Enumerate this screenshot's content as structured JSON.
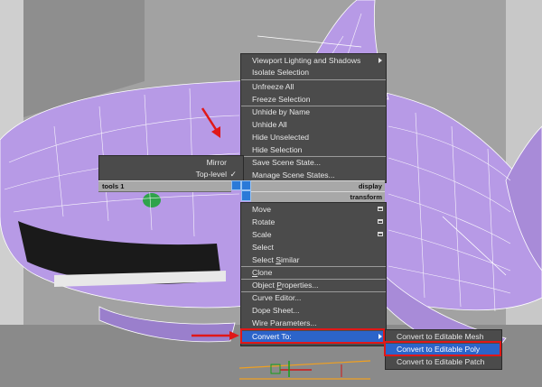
{
  "quad_menu": {
    "top_right": [
      {
        "label": "Viewport Lighting and Shadows",
        "submenu": true
      },
      {
        "label": "Isolate Selection"
      },
      {
        "label": "Unfreeze All"
      },
      {
        "label": "Freeze Selection"
      },
      {
        "label": "Unhide by Name"
      },
      {
        "label": "Unhide All"
      },
      {
        "label": "Hide Unselected"
      },
      {
        "label": "Hide Selection"
      },
      {
        "label": "Save Scene State..."
      },
      {
        "label": "Manage Scene States..."
      }
    ],
    "top_left": [
      {
        "label": "Mirror"
      },
      {
        "label": "Top-level",
        "checked": "✓"
      }
    ],
    "display_header": "display",
    "tools_header": "tools 1",
    "transform_header": "transform",
    "bottom_right": [
      {
        "label": "Move",
        "options": true
      },
      {
        "label": "Rotate",
        "options": true
      },
      {
        "label": "Scale",
        "options": true
      },
      {
        "label": "Select"
      },
      {
        "label_pre": "Select ",
        "label_u": "S",
        "label_post": "imilar"
      },
      {
        "label_pre": "",
        "label_u": "C",
        "label_post": "lone"
      },
      {
        "label_pre": "Object ",
        "label_u": "P",
        "label_post": "roperties..."
      },
      {
        "label": "Curve Editor..."
      },
      {
        "label": "Dope Sheet..."
      },
      {
        "label": "Wire Parameters..."
      },
      {
        "label": "Convert To:",
        "submenu": true,
        "highlighted": true
      }
    ],
    "convert_submenu": [
      {
        "label": "Convert to Editable Mesh"
      },
      {
        "label": "Convert to Editable Poly",
        "highlighted": true
      },
      {
        "label": "Convert to Editable Patch"
      }
    ]
  },
  "colors": {
    "menu_bg": "#4b4b4b",
    "highlight": "#2c64c9",
    "annotation_red": "#e01818",
    "model_purple": "#b79ae6"
  },
  "icons": [
    "submenu-arrow-icon",
    "options-box-icon",
    "checkmark-icon",
    "red-arrow-annotation"
  ]
}
